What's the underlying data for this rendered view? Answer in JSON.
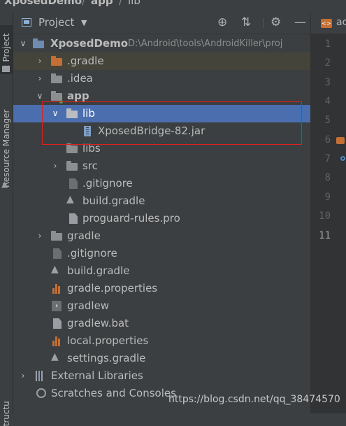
{
  "breadcrumb": {
    "project": "XposedDemo",
    "module": "app",
    "folder": "lib",
    "separator": "/"
  },
  "left_stripe": {
    "project_tab": "1: Project",
    "resource_manager_tab": "Resource Manager",
    "structure_tab": "Structure"
  },
  "panel": {
    "title": "Project"
  },
  "tree": {
    "root_name": "XposedDemo",
    "root_path": "D:\\Android\\tools\\AndroidKiller\\proj",
    "gradle_hidden": ".gradle",
    "idea": ".idea",
    "app": "app",
    "lib": "lib",
    "jar": "XposedBridge-82.jar",
    "libs": "libs",
    "src": "src",
    "app_gitignore": ".gitignore",
    "app_build_gradle": "build.gradle",
    "proguard": "proguard-rules.pro",
    "gradle": "gradle",
    "gitignore": ".gitignore",
    "build_gradle": "build.gradle",
    "gradle_properties": "gradle.properties",
    "gradlew": "gradlew",
    "gradlew_bat": "gradlew.bat",
    "local_properties": "local.properties",
    "settings_gradle": "settings.gradle",
    "external_libraries": "External Libraries",
    "scratches": "Scratches and Consoles"
  },
  "editor": {
    "tab_label": "ac",
    "line_numbers": [
      "1",
      "2",
      "3",
      "4",
      "5",
      "6",
      "7",
      "8",
      "9",
      "10",
      "11"
    ]
  },
  "watermark": "https://blog.csdn.net/qq_38474570",
  "colors": {
    "selection": "#4b6eaf",
    "highlight_box": "#e02020",
    "module_folder": "#c46f33"
  }
}
